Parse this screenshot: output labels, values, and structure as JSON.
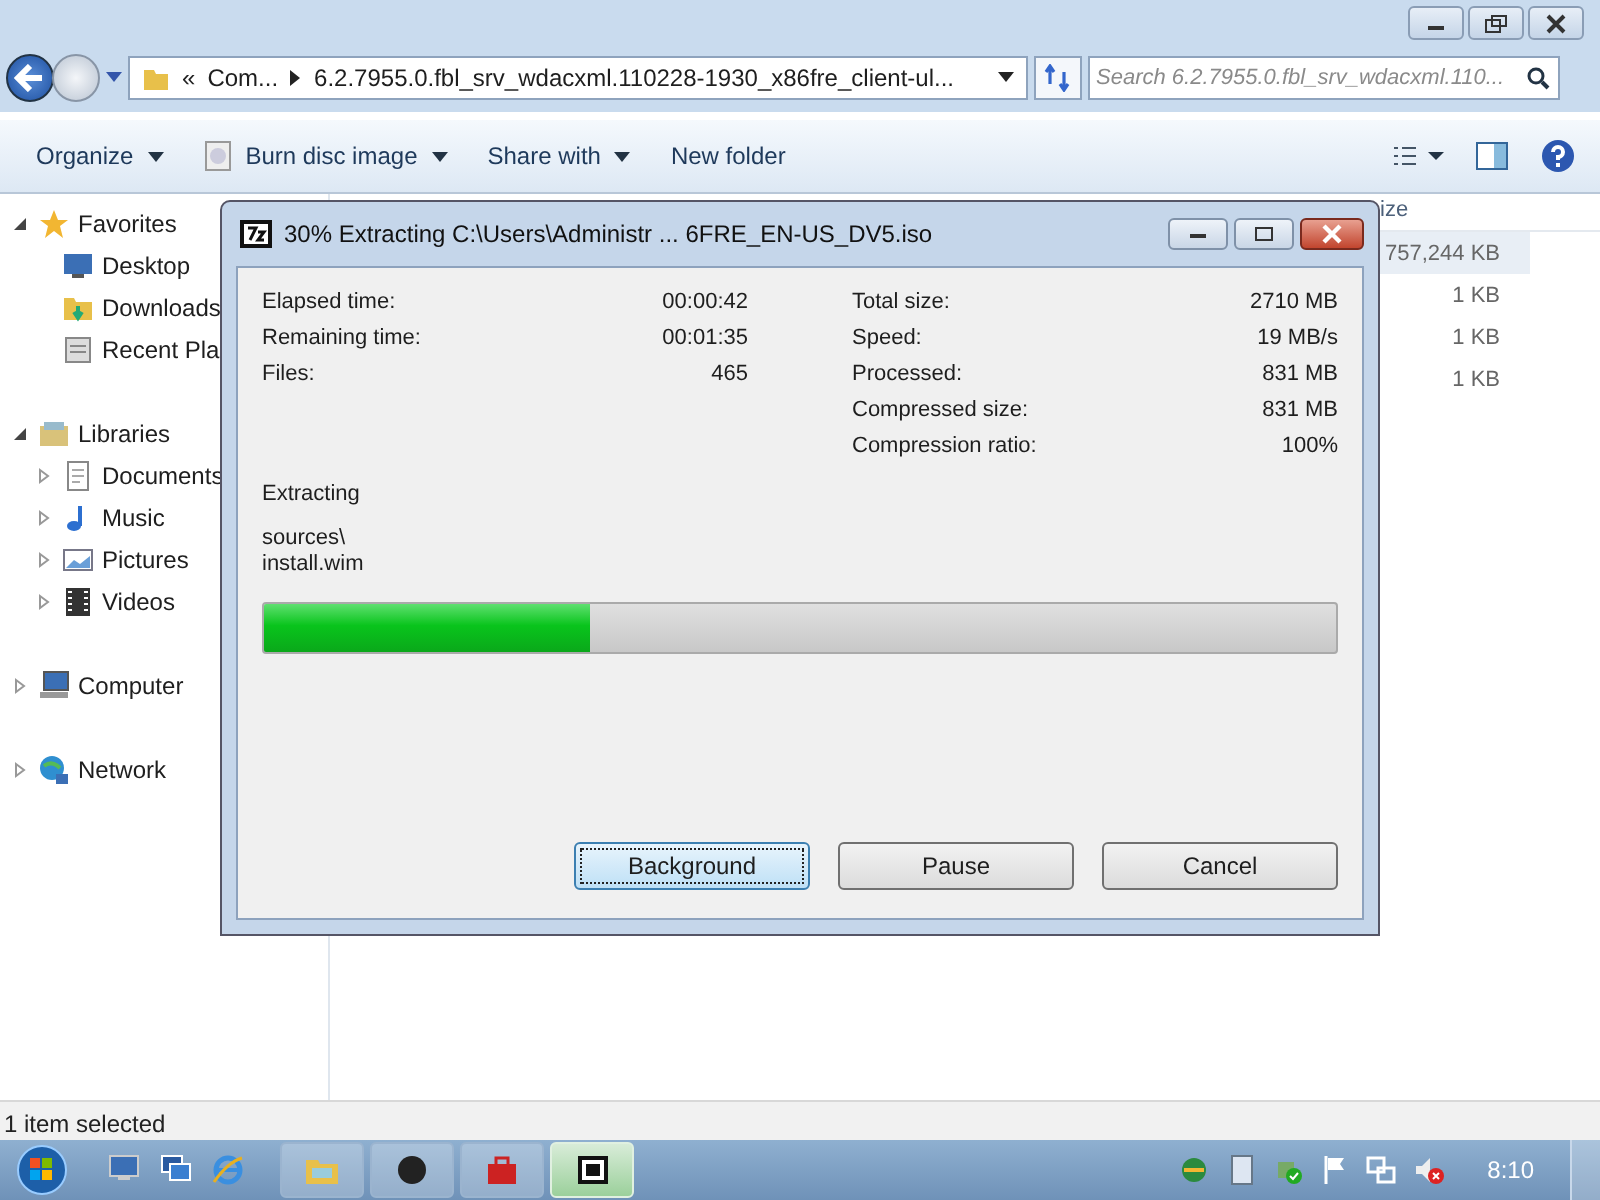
{
  "explorer": {
    "address": {
      "overflow_marker": "«",
      "crumbs": [
        "Com...",
        "6.2.7955.0.fbl_srv_wdacxml.110228-1930_x86fre_client-ul..."
      ]
    },
    "search": {
      "placeholder": "Search 6.2.7955.0.fbl_srv_wdacxml.110..."
    },
    "toolbar": [
      {
        "label": "Organize",
        "dropdown": true
      },
      {
        "label": "Burn disc image",
        "dropdown": true
      },
      {
        "label": "Share with",
        "dropdown": true
      },
      {
        "label": "New folder",
        "dropdown": false
      }
    ],
    "column_header": "ize",
    "sizes": [
      "757,244 KB",
      "1 KB",
      "1 KB",
      "1 KB"
    ],
    "nav": [
      {
        "label": "Favorites",
        "expanded": true,
        "children": [
          {
            "label": "Desktop"
          },
          {
            "label": "Downloads"
          },
          {
            "label": "Recent Pla"
          }
        ]
      },
      {
        "label": "Libraries",
        "expanded": true,
        "children": [
          {
            "label": "Documents",
            "expanded": false
          },
          {
            "label": "Music",
            "expanded": false
          },
          {
            "label": "Pictures",
            "expanded": false
          },
          {
            "label": "Videos",
            "expanded": false
          }
        ]
      },
      {
        "label": "Computer",
        "expanded": false
      },
      {
        "label": "Network",
        "expanded": false
      }
    ],
    "status_bar": "1 item selected"
  },
  "dialog": {
    "title": "30% Extracting C:\\Users\\Administr ... 6FRE_EN-US_DV5.iso",
    "left_stats": [
      {
        "label": "Elapsed time:",
        "value": "00:00:42"
      },
      {
        "label": "Remaining time:",
        "value": "00:01:35"
      },
      {
        "label": "Files:",
        "value": "465"
      }
    ],
    "right_stats": [
      {
        "label": "Total size:",
        "value": "2710 MB"
      },
      {
        "label": "Speed:",
        "value": "19 MB/s"
      },
      {
        "label": "Processed:",
        "value": "831 MB"
      },
      {
        "label": "Compressed size:",
        "value": "831 MB"
      },
      {
        "label": "Compression ratio:",
        "value": "100%"
      }
    ],
    "operation": "Extracting",
    "path_lines": [
      "sources\\",
      "install.wim"
    ],
    "progress": {
      "level": 0.305
    },
    "buttons": [
      {
        "label": "Background",
        "focused": true
      },
      {
        "label": "Pause",
        "focused": false
      },
      {
        "label": "Cancel",
        "focused": false
      }
    ]
  },
  "taskbar": {
    "tasks": [
      {
        "active": false
      },
      {
        "active": false
      },
      {
        "active": false
      },
      {
        "active": true
      }
    ],
    "clock": "8:10"
  }
}
